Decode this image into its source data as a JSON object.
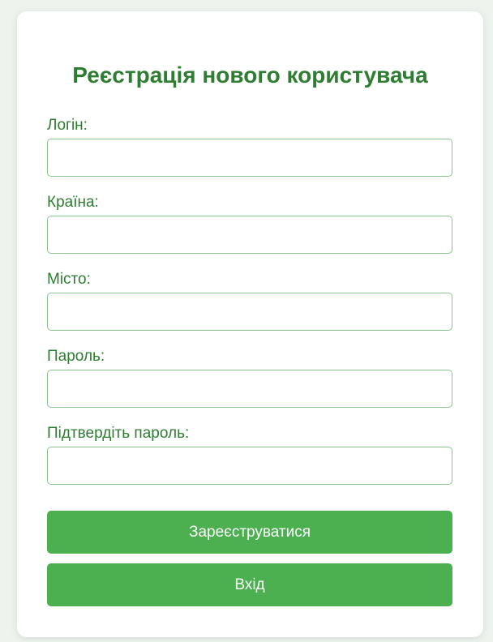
{
  "form": {
    "title": "Реєстрація нового користувача",
    "fields": [
      {
        "label": "Логін:",
        "value": ""
      },
      {
        "label": "Країна:",
        "value": ""
      },
      {
        "label": "Місто:",
        "value": ""
      },
      {
        "label": "Пароль:",
        "value": ""
      },
      {
        "label": "Підтвердіть пароль:",
        "value": ""
      }
    ],
    "register_label": "Зареєструватися",
    "login_label": "Вхід"
  },
  "colors": {
    "accent": "#4caf50",
    "title": "#2e7d32",
    "input_border": "#8bc48d",
    "page_background": "#eef3ee"
  }
}
